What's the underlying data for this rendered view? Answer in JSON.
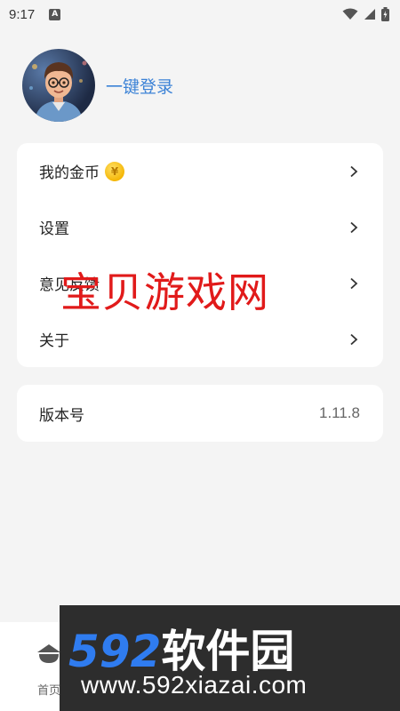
{
  "status_bar": {
    "time": "9:17",
    "notif_letter": "A"
  },
  "profile": {
    "login_label": "一键登录"
  },
  "menu": {
    "items": [
      {
        "label": "我的金币",
        "has_coin": true
      },
      {
        "label": "设置"
      },
      {
        "label": "意见反馈"
      },
      {
        "label": "关于"
      }
    ],
    "coin_symbol": "¥"
  },
  "version": {
    "label": "版本号",
    "value": "1.11.8"
  },
  "watermark": {
    "text": "宝贝游戏网"
  },
  "bottom_nav": {
    "home_label": "首页"
  },
  "banner": {
    "brand_num": "592",
    "brand_cn": "软件园",
    "url": "www.592xiazai.com"
  },
  "colors": {
    "accent": "#3b82d6",
    "watermark": "#e11a1a",
    "banner_bg": "#2d2d2d",
    "coin": "#f4b400"
  }
}
